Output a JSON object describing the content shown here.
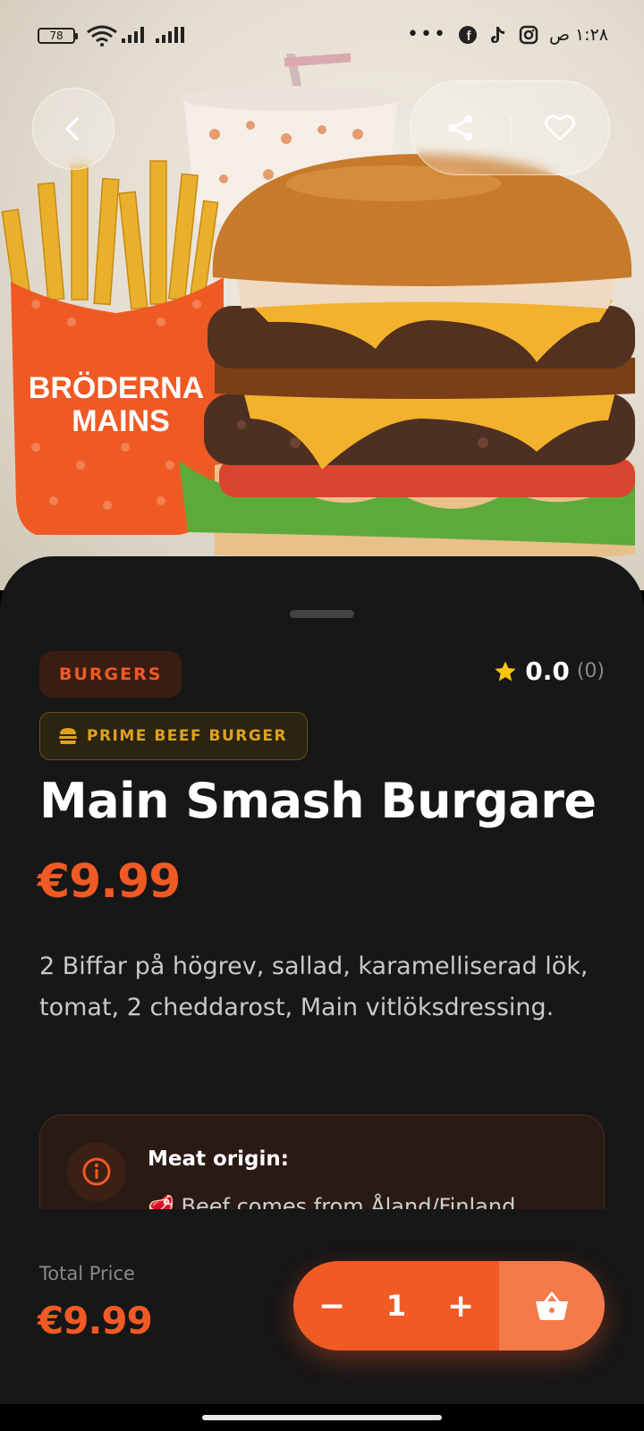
{
  "status_bar": {
    "battery": "78",
    "time": "١:٢٨ ص",
    "overflow": "•••",
    "icons": [
      "wifi-icon",
      "signal-icon",
      "facebook-icon",
      "tiktok-icon",
      "instagram-icon"
    ]
  },
  "hero": {
    "image": "burger-fries-drink-photo",
    "brand_on_fries_box": "BRÖDERNA MAINS"
  },
  "product": {
    "category": "BURGERS",
    "subcategory": "PRIME BEEF BURGER",
    "rating": "0.0",
    "rating_count": "(0)",
    "name": "Main Smash Burgare",
    "price": "€9.99",
    "description": "2 Biffar på högrev, sallad, karamelliserad lök, tomat, 2 cheddarost, Main vitlöksdressing."
  },
  "info_card": {
    "title": "Meat origin:",
    "line": "🥩 Beef comes from Åland/Finland"
  },
  "bottom": {
    "total_label": "Total Price",
    "total_price": "€9.99",
    "quantity": "1",
    "minus": "−",
    "plus": "+"
  },
  "colors": {
    "accent": "#f05a24",
    "accent_light": "#f47a4a",
    "sheet_bg": "#171717",
    "gold": "#e0a21c",
    "star": "#f5c518"
  }
}
